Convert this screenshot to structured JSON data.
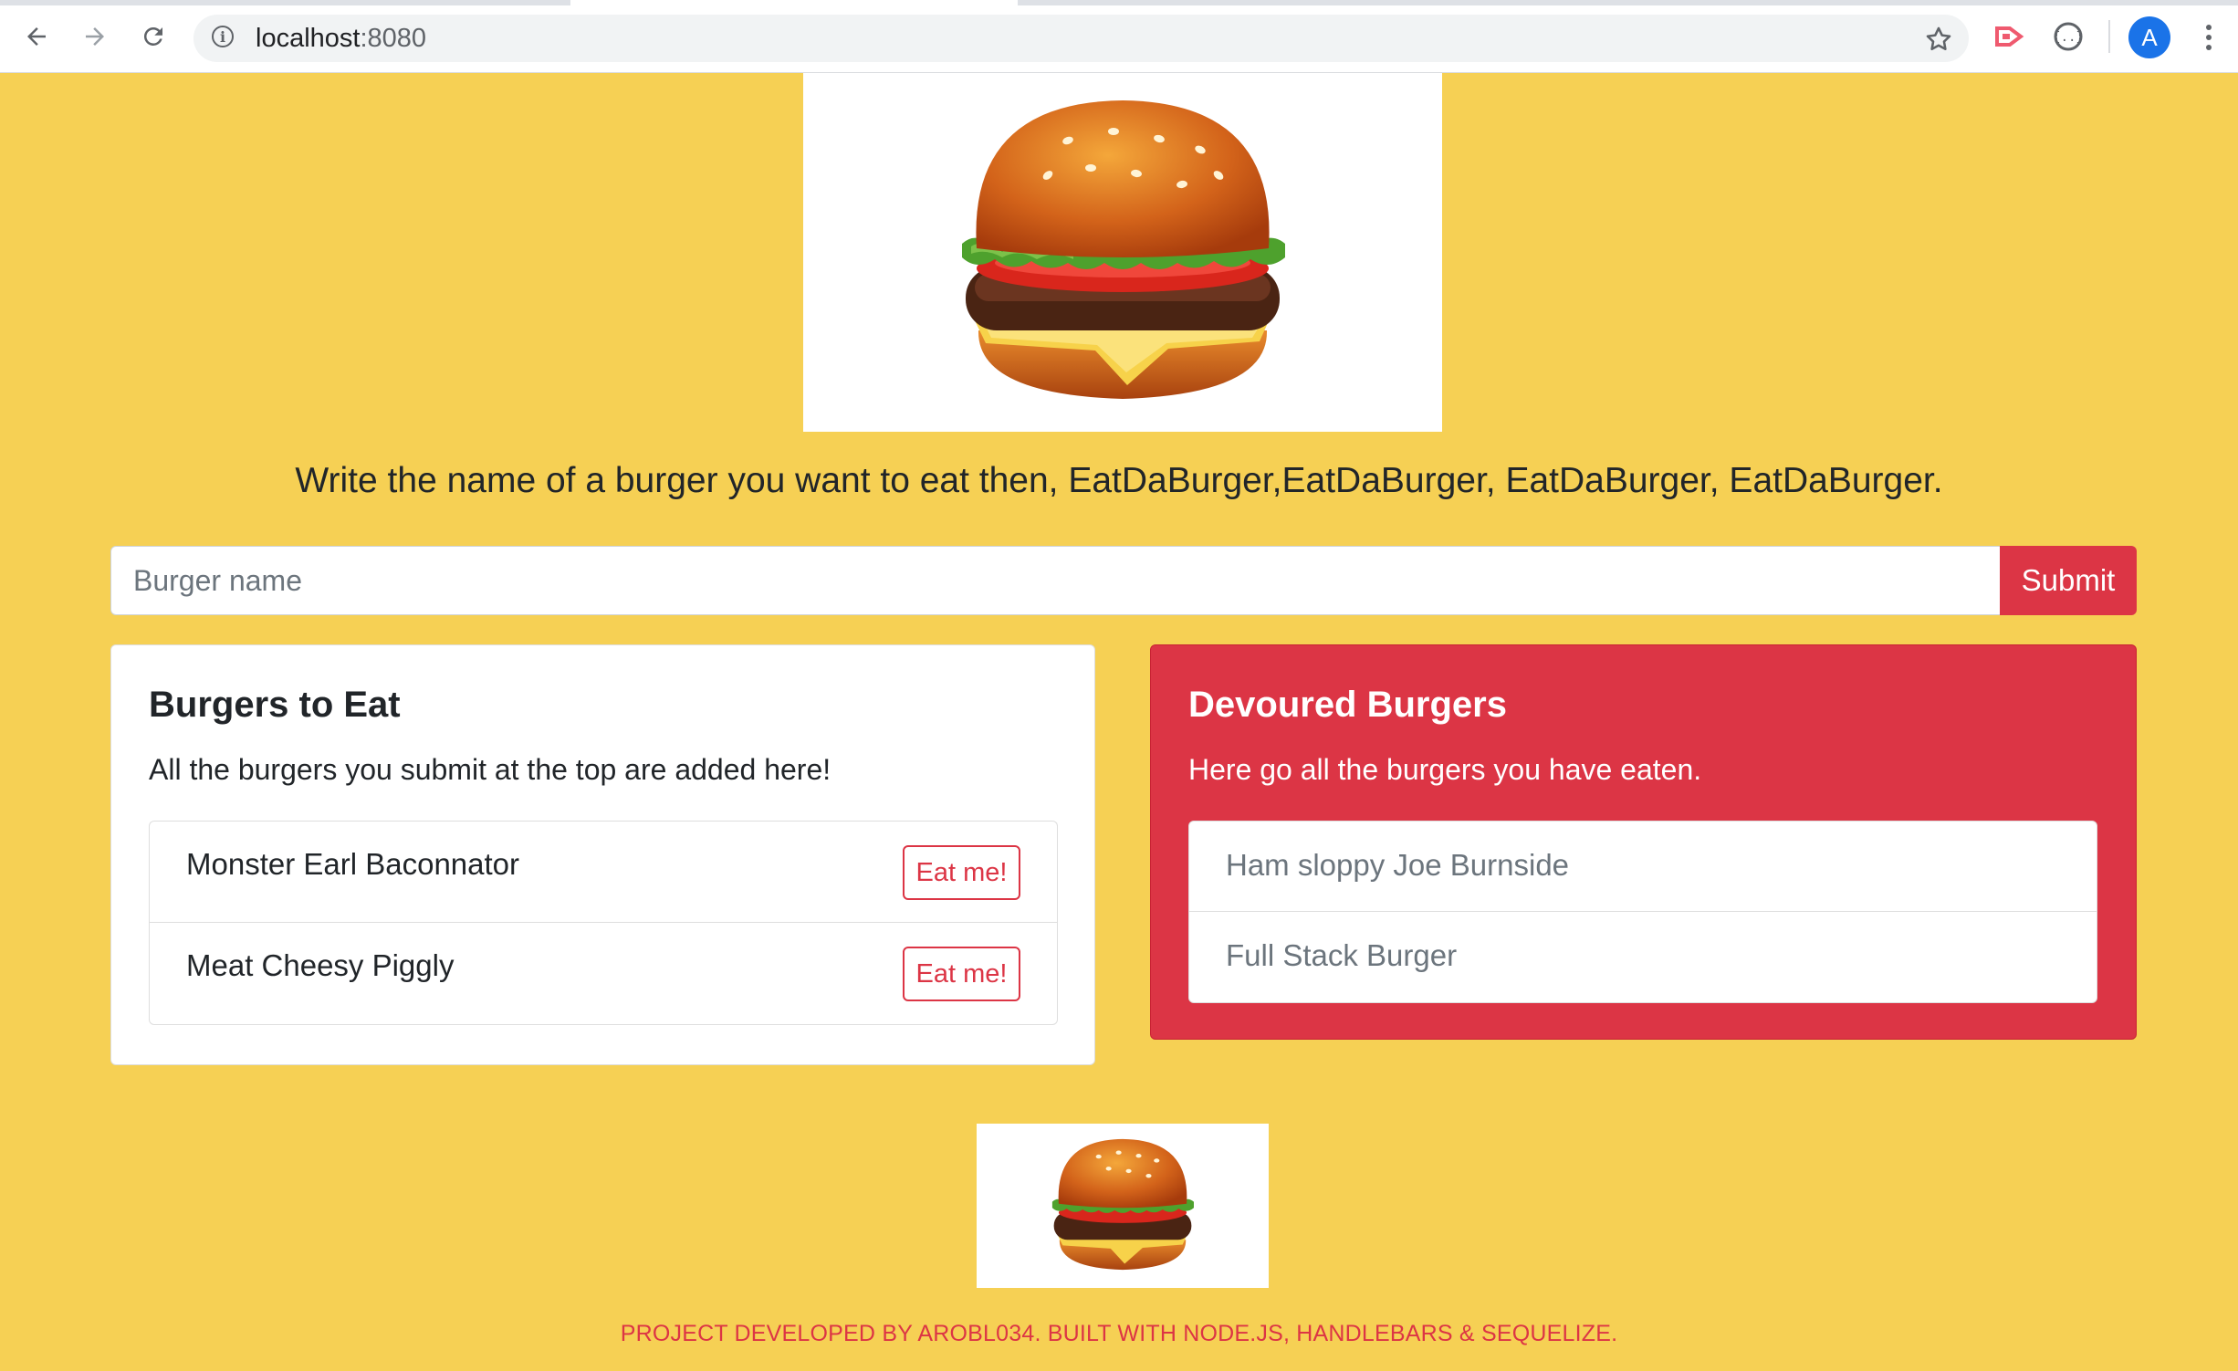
{
  "browser": {
    "url_host": "localhost",
    "url_port": ":8080",
    "avatar_letter": "A"
  },
  "icons": {
    "back": "back-arrow-icon",
    "forward": "forward-arrow-icon",
    "reload": "reload-icon",
    "site_info": "info-icon",
    "bookmark": "star-icon",
    "extension_1": "cast-extension-icon",
    "extension_2": "devtools-extension-icon",
    "menu": "kebab-menu-icon",
    "hero": "hamburger-icon",
    "footer": "hamburger-icon"
  },
  "page": {
    "intro": "Write the name of a burger you want to eat then, EatDaBurger,EatDaBurger, EatDaBurger, EatDaBurger.",
    "input_placeholder": "Burger name",
    "submit_label": "Submit",
    "credits": "PROJECT DEVELOPED BY AROBL034. BUILT WITH NODE.JS, HANDLEBARS & SEQUELIZE."
  },
  "to_eat": {
    "title": "Burgers to Eat",
    "text": "All the burgers you submit at the top are added here!",
    "items": [
      {
        "name": "Monster Earl Baconnator",
        "button": "Eat me!"
      },
      {
        "name": "Meat Cheesy Piggly",
        "button": "Eat me!"
      }
    ]
  },
  "devoured": {
    "title": "Devoured Burgers",
    "text": "Here go all the burgers you have eaten.",
    "items": [
      {
        "name": "Ham sloppy Joe Burnside"
      },
      {
        "name": "Full Stack Burger"
      }
    ]
  },
  "colors": {
    "page_background": "#f6d054",
    "accent_red": "#dc3545",
    "avatar_blue": "#1a73e8"
  }
}
